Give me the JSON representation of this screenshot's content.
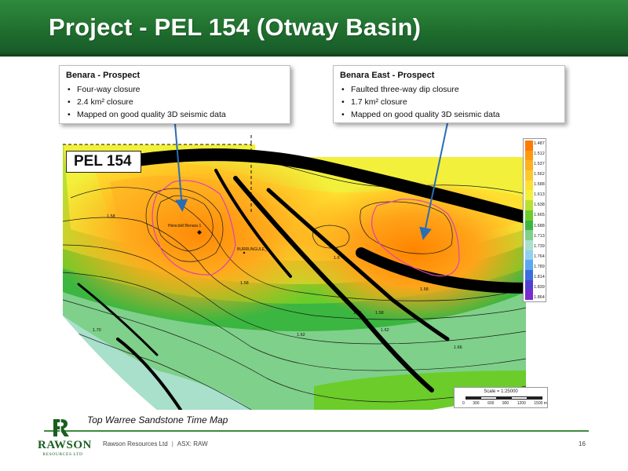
{
  "slide": {
    "title": "Project - PEL 154 (Otway Basin)",
    "map_caption": "Top Warree Sandstone Time Map",
    "page_number": "16"
  },
  "map": {
    "pel_label": "PEL 154",
    "well_label": "Hieocdell Benara 1",
    "well_label_2": "BURRUNGULE_1",
    "contour_labels": [
      "1.58",
      "1.58",
      "1.6",
      "1.58",
      "1.58",
      "1.55",
      "1.62",
      "1.62",
      "1.66",
      "1.70"
    ],
    "colors": {
      "fault": "#000000",
      "prospect_outline": "#e040b0",
      "arrow": "#2a6db5"
    }
  },
  "callouts": {
    "left": {
      "title": "Benara - Prospect",
      "items": [
        "Four-way closure",
        "2.4 km² closure",
        "Mapped on good quality 3D seismic data"
      ]
    },
    "right": {
      "title": "Benara East - Prospect",
      "items": [
        "Faulted three-way dip closure",
        "1.7 km² closure",
        "Mapped on good quality 3D seismic data"
      ]
    }
  },
  "legend": {
    "labels": [
      "1.487",
      "1.512",
      "1.537",
      "1.562",
      "1.588",
      "1.613",
      "1.638",
      "1.665",
      "1.688",
      "1.713",
      "1.739",
      "1.764",
      "1.789",
      "1.814",
      "1.839",
      "1.864"
    ],
    "colors": [
      "#ff7a00",
      "#ff9a10",
      "#ffb020",
      "#ffc82a",
      "#ffe030",
      "#f2f03a",
      "#b8e030",
      "#6ccc2a",
      "#3bb640",
      "#7fd08a",
      "#a8e0cc",
      "#8fd0f0",
      "#5aa8f0",
      "#3a6ee0",
      "#5040d0",
      "#7a2ad0"
    ]
  },
  "scale": {
    "text": "Scale = 1:25000",
    "ticks": [
      "0",
      "300",
      "600",
      "900",
      "1200",
      "1500 m"
    ]
  },
  "footer": {
    "company": "Rawson Resources Ltd",
    "ticker": "ASX: RAW",
    "logo_name": "RAWSON",
    "logo_sub": "RESOURCES LTD"
  }
}
